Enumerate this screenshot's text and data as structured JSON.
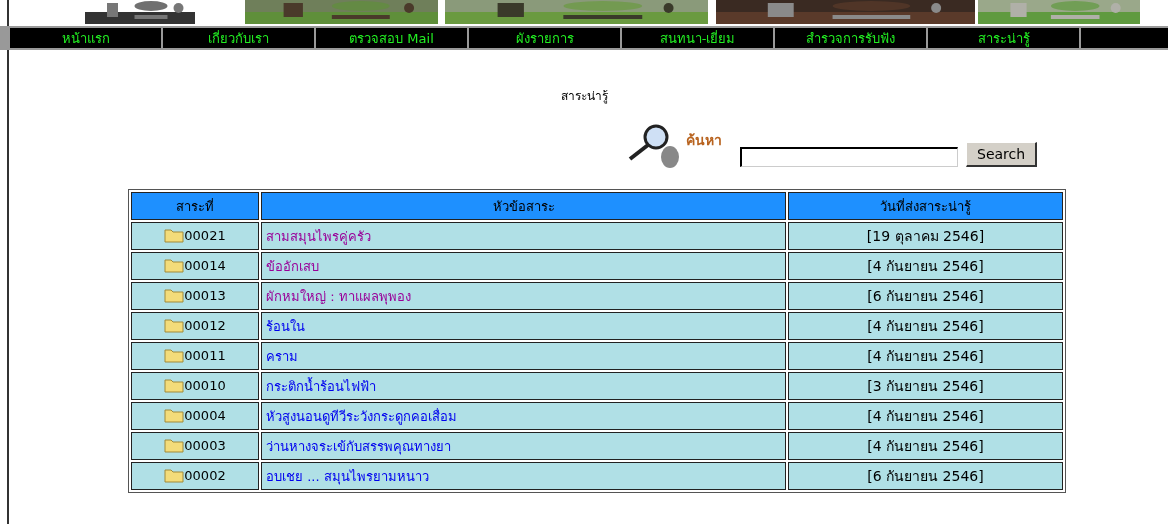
{
  "nav": [
    "หน้าแรก",
    "เกี่ยวกับเรา",
    "ตรวจสอบ Mail",
    "ผังรายการ",
    "สนทนา-เยี่ยม",
    "สำรวจการรับฟัง",
    "สาระน่ารู้"
  ],
  "heading": "สาระน่ารู้",
  "search": {
    "label": "ค้นหา",
    "button": "Search"
  },
  "table": {
    "columns": [
      "สาระที่",
      "หัวข้อสาระ",
      "วันที่ส่งสาระน่ารู้"
    ],
    "rows": [
      {
        "id": "00021",
        "title": "สามสมุนไพรคู่ครัว",
        "visited": true,
        "date": "[19 ตุลาคม 2546]"
      },
      {
        "id": "00014",
        "title": "ข้ออักเสบ",
        "visited": true,
        "date": "[4 กันยายน 2546]"
      },
      {
        "id": "00013",
        "title": "ผักหมใหญ่ : ทาแผลพุพอง",
        "visited": true,
        "date": "[6 กันยายน 2546]"
      },
      {
        "id": "00012",
        "title": "ร้อนใน",
        "visited": false,
        "date": "[4 กันยายน 2546]"
      },
      {
        "id": "00011",
        "title": "คราม",
        "visited": false,
        "date": "[4 กันยายน 2546]"
      },
      {
        "id": "00010",
        "title": "กระติกน้ำร้อนไฟฟ้า",
        "visited": false,
        "date": "[3 กันยายน 2546]"
      },
      {
        "id": "00004",
        "title": "หัวสูงนอนดูทีวีระวังกระดูกคอเสื่อม",
        "visited": false,
        "date": "[4 กันยายน 2546]"
      },
      {
        "id": "00003",
        "title": "ว่านหางจระเข้กับสรรพคุณทางยา",
        "visited": false,
        "date": "[4 กันยายน 2546]"
      },
      {
        "id": "00002",
        "title": "อบเชย ... สมุนไพรยามหนาว",
        "visited": false,
        "date": "[6 กันยายน 2546]"
      }
    ]
  }
}
